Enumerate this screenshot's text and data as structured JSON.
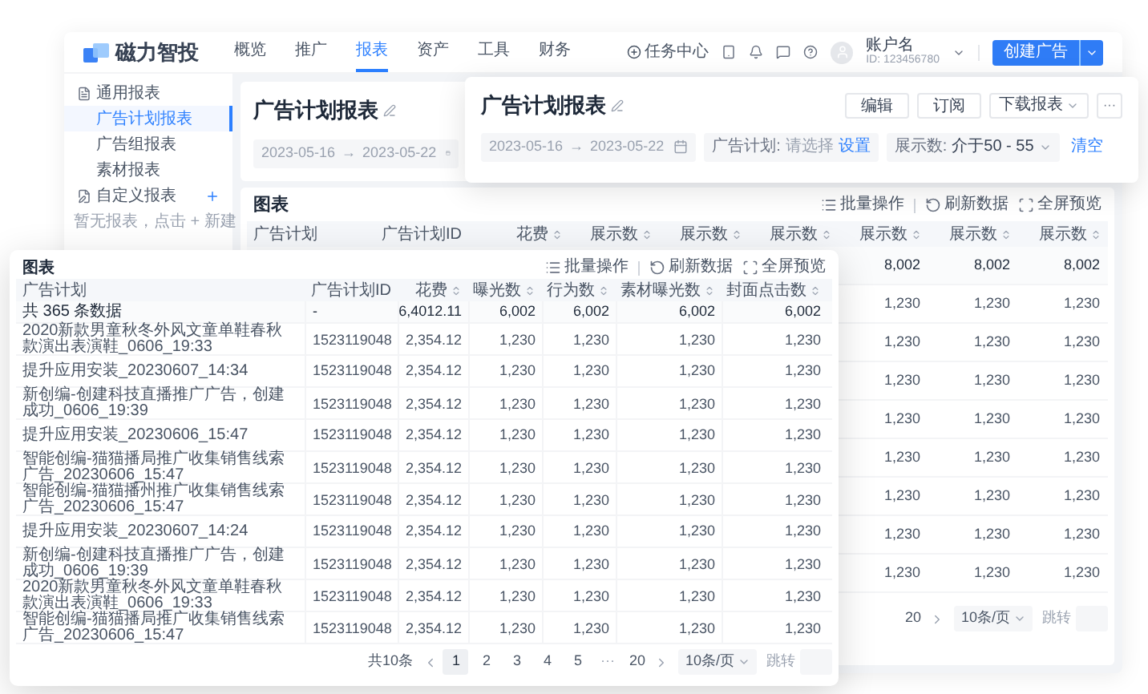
{
  "nav": {
    "brand": "磁力智投",
    "menu": [
      {
        "label": "概览",
        "selected": false
      },
      {
        "label": "推广",
        "selected": false
      },
      {
        "label": "报表",
        "selected": true
      },
      {
        "label": "资产",
        "selected": false
      },
      {
        "label": "工具",
        "selected": false
      },
      {
        "label": "财务",
        "selected": false
      }
    ],
    "task_center": "任务中心",
    "account": {
      "name": "账户名",
      "id": "ID: 123456780"
    },
    "create_button": "创建广告"
  },
  "sidebar": {
    "items": [
      {
        "kind": "group",
        "label": "通用报表",
        "selected": false
      },
      {
        "kind": "item",
        "label": "广告计划报表",
        "selected": true
      },
      {
        "kind": "item",
        "label": "广告组报表",
        "selected": false
      },
      {
        "kind": "item",
        "label": "素材报表",
        "selected": false
      },
      {
        "kind": "custom_group",
        "label": "自定义报表",
        "selected": false
      },
      {
        "kind": "hint",
        "label": "暂无报表，点击 + 新建",
        "selected": false
      }
    ]
  },
  "back_report": {
    "title": "广告计划报表",
    "date_range": {
      "start": "2023-05-16",
      "separator": "→",
      "end": "2023-05-22"
    }
  },
  "report_card": {
    "title": "广告计划报表",
    "buttons": [
      {
        "kind": "plain",
        "label": "编辑"
      },
      {
        "kind": "plain",
        "label": "订阅"
      },
      {
        "kind": "dropdown",
        "label": "下载报表"
      },
      {
        "kind": "more",
        "label": "···"
      }
    ],
    "date_range": {
      "start": "2023-05-16",
      "separator": "→",
      "end": "2023-05-22"
    },
    "filters": [
      {
        "kind": "select",
        "label": "广告计划:",
        "placeholder": "请选择",
        "action": "设置"
      },
      {
        "kind": "dropdown",
        "label": "展示数:",
        "value": "介于50 - 55"
      }
    ],
    "clear": "清空"
  },
  "back_chart": {
    "title": "图表",
    "tools": [
      {
        "kind": "batch",
        "label": "批量操作"
      },
      {
        "kind": "refresh",
        "label": "刷新数据"
      },
      {
        "kind": "fullscreen",
        "label": "全屏预览"
      }
    ],
    "columns": [
      {
        "label": "广告计划",
        "sortable": false
      },
      {
        "label": "广告计划ID",
        "sortable": false
      },
      {
        "label": "花费",
        "sortable": true
      },
      {
        "label": "展示数",
        "sortable": true
      },
      {
        "label": "展示数",
        "sortable": true
      },
      {
        "label": "展示数",
        "sortable": true
      },
      {
        "label": "展示数",
        "sortable": true
      },
      {
        "label": "展示数",
        "sortable": true
      },
      {
        "label": "展示数",
        "sortable": true
      }
    ],
    "rows": [
      {
        "total": true,
        "cells": [
          "8,002",
          "8,002",
          "8,002"
        ]
      },
      {
        "total": false,
        "cells": [
          "1,230",
          "1,230",
          "1,230"
        ]
      },
      {
        "total": false,
        "cells": [
          "1,230",
          "1,230",
          "1,230"
        ]
      },
      {
        "total": false,
        "cells": [
          "1,230",
          "1,230",
          "1,230"
        ]
      },
      {
        "total": false,
        "cells": [
          "1,230",
          "1,230",
          "1,230"
        ]
      },
      {
        "total": false,
        "cells": [
          "1,230",
          "1,230",
          "1,230"
        ]
      },
      {
        "total": false,
        "cells": [
          "1,230",
          "1,230",
          "1,230"
        ]
      },
      {
        "total": false,
        "cells": [
          "1,230",
          "1,230",
          "1,230"
        ]
      },
      {
        "total": false,
        "cells": [
          "1,230",
          "1,230",
          "1,230"
        ]
      }
    ],
    "pagination": {
      "prev": false,
      "items": [
        {
          "kind": "page",
          "label": "20",
          "selected": false
        }
      ],
      "next": true,
      "page_size": "10条/页",
      "jump_label": "跳转"
    }
  },
  "front_chart": {
    "title": "图表",
    "tools": [
      {
        "kind": "batch",
        "label": "批量操作"
      },
      {
        "kind": "refresh",
        "label": "刷新数据"
      },
      {
        "kind": "fullscreen",
        "label": "全屏预览"
      }
    ],
    "columns": [
      {
        "label": "广告计划",
        "sortable": false
      },
      {
        "label": "广告计划ID",
        "sortable": false
      },
      {
        "label": "花费",
        "sortable": true
      },
      {
        "label": "曝光数",
        "sortable": true
      },
      {
        "label": "行为数",
        "sortable": true
      },
      {
        "label": "素材曝光数",
        "sortable": true
      },
      {
        "label": "封面点击数",
        "sortable": true
      }
    ],
    "rows": [
      {
        "total": true,
        "cells": [
          "共 365 条数据",
          "-",
          "6,4012.11",
          "6,002",
          "6,002",
          "6,002",
          "6,002"
        ]
      },
      {
        "total": false,
        "cells": [
          "2020新款男童秋冬外风文童单鞋春秋款演出表演鞋_0606_19:33",
          "1523119048",
          "2,354.12",
          "1,230",
          "1,230",
          "1,230",
          "1,230"
        ]
      },
      {
        "total": false,
        "cells": [
          "提升应用安装_20230607_14:34",
          "1523119048",
          "2,354.12",
          "1,230",
          "1,230",
          "1,230",
          "1,230"
        ]
      },
      {
        "total": false,
        "cells": [
          "新创编-创建科技直播推广广告，创建成功_0606_19:39",
          "1523119048",
          "2,354.12",
          "1,230",
          "1,230",
          "1,230",
          "1,230"
        ]
      },
      {
        "total": false,
        "cells": [
          "提升应用安装_20230606_15:47",
          "1523119048",
          "2,354.12",
          "1,230",
          "1,230",
          "1,230",
          "1,230"
        ]
      },
      {
        "total": false,
        "cells": [
          "智能创编-猫猫播局推广收集销售线索广告_20230606_15:47",
          "1523119048",
          "2,354.12",
          "1,230",
          "1,230",
          "1,230",
          "1,230"
        ]
      },
      {
        "total": false,
        "cells": [
          "智能创编-猫猫播州推广收集销售线索广告_20230606_15:47",
          "1523119048",
          "2,354.12",
          "1,230",
          "1,230",
          "1,230",
          "1,230"
        ]
      },
      {
        "total": false,
        "cells": [
          "提升应用安装_20230607_14:24",
          "1523119048",
          "2,354.12",
          "1,230",
          "1,230",
          "1,230",
          "1,230"
        ]
      },
      {
        "total": false,
        "cells": [
          "新创编-创建科技直播推广广告，创建成功_0606_19:39",
          "1523119048",
          "2,354.12",
          "1,230",
          "1,230",
          "1,230",
          "1,230"
        ]
      },
      {
        "total": false,
        "cells": [
          "2020新款男童秋冬外风文童单鞋春秋款演出表演鞋_0606_19:33",
          "1523119048",
          "2,354.12",
          "1,230",
          "1,230",
          "1,230",
          "1,230"
        ]
      },
      {
        "total": false,
        "cells": [
          "智能创编-猫猫播局推广收集销售线索广告_20230606_15:47",
          "1523119048",
          "2,354.12",
          "1,230",
          "1,230",
          "1,230",
          "1,230"
        ]
      }
    ],
    "pagination": {
      "total": "共10条",
      "prev": true,
      "items": [
        {
          "kind": "page",
          "label": "1",
          "selected": true
        },
        {
          "kind": "page",
          "label": "2",
          "selected": false
        },
        {
          "kind": "page",
          "label": "3",
          "selected": false
        },
        {
          "kind": "page",
          "label": "4",
          "selected": false
        },
        {
          "kind": "page",
          "label": "5",
          "selected": false
        },
        {
          "kind": "ellipsis",
          "label": "···",
          "selected": false
        },
        {
          "kind": "page",
          "label": "20",
          "selected": false
        }
      ],
      "next": true,
      "page_size": "10条/页",
      "jump_label": "跳转"
    }
  }
}
